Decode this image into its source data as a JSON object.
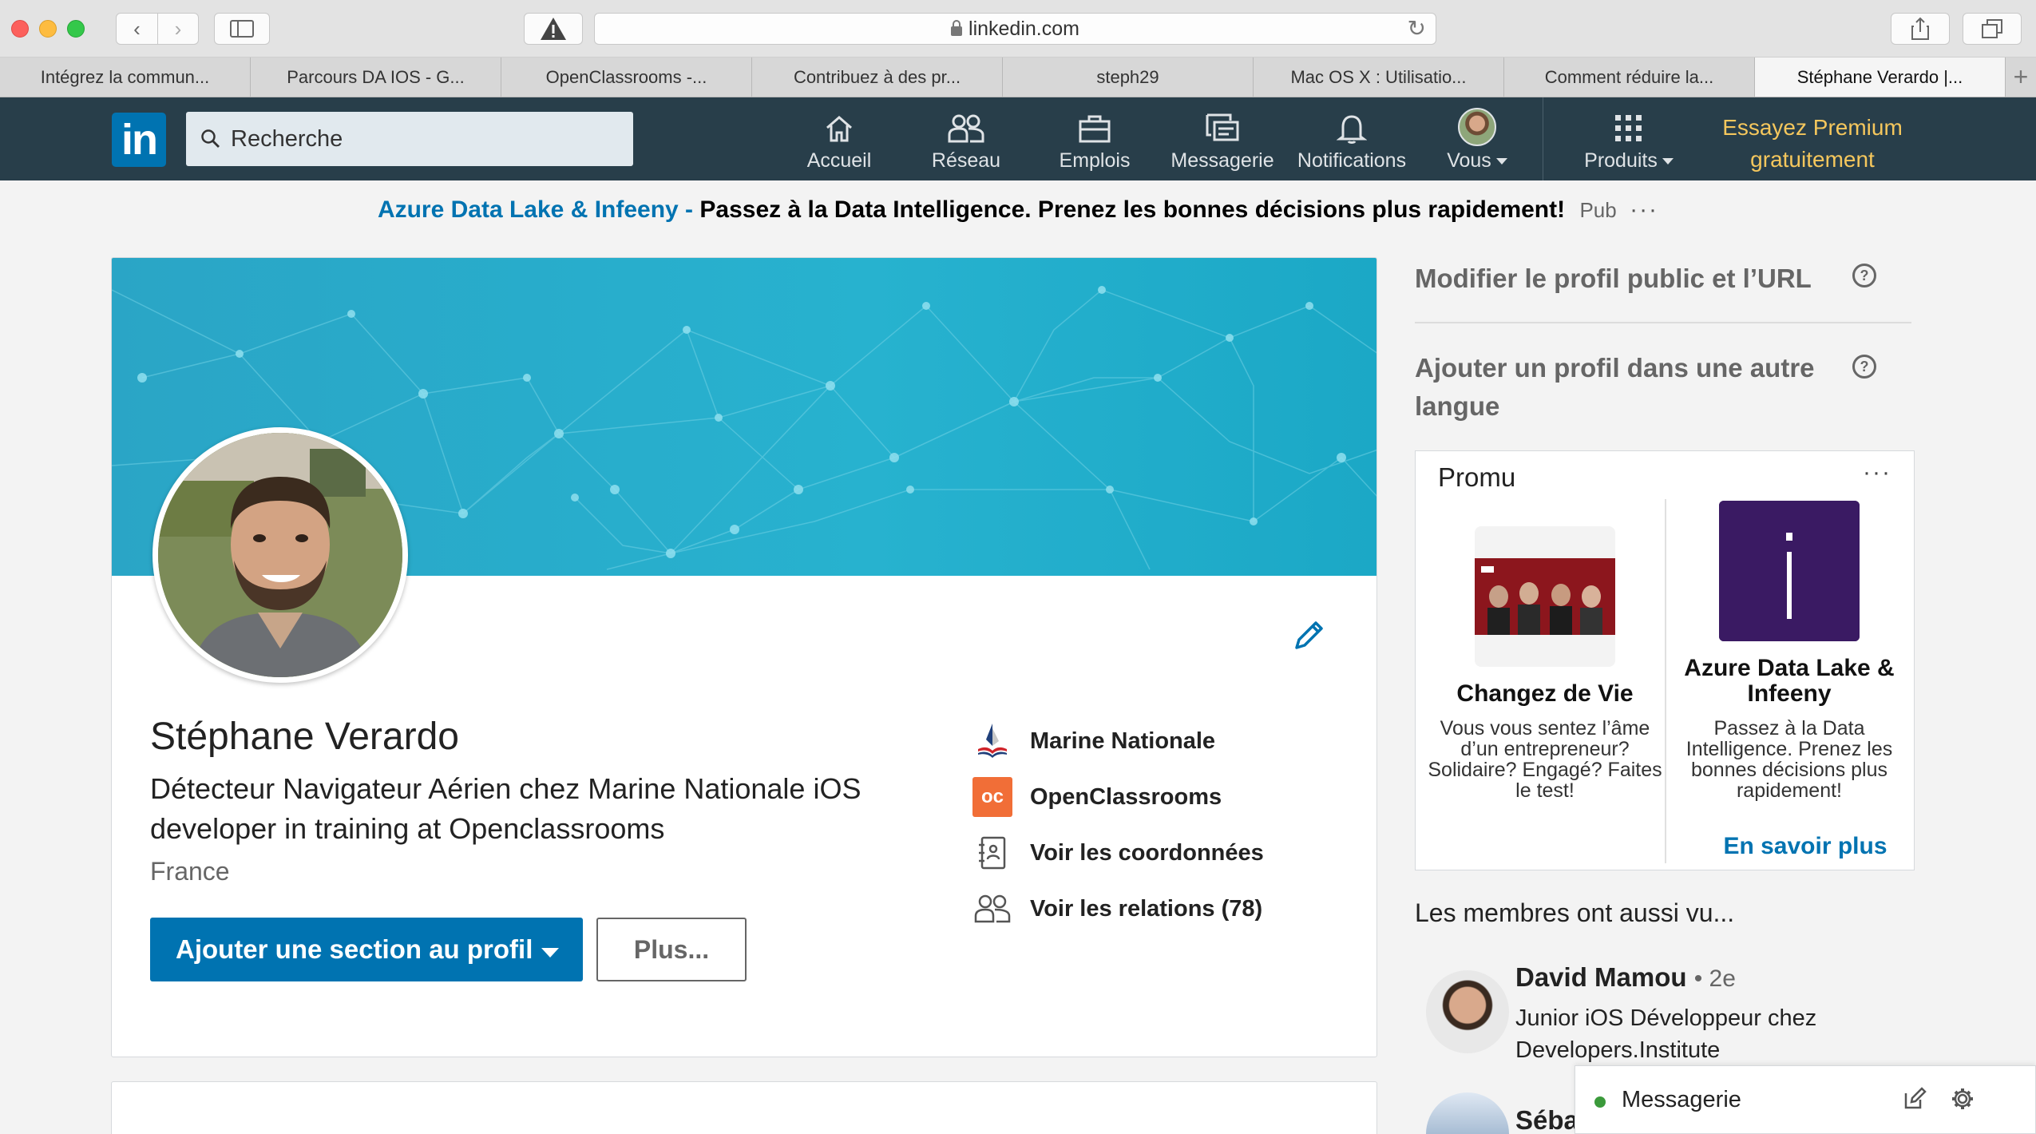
{
  "browser": {
    "url": "linkedin.com",
    "tabs": [
      {
        "label": "Intégrez la commun...",
        "active": false
      },
      {
        "label": "Parcours DA IOS - G...",
        "active": false
      },
      {
        "label": "OpenClassrooms -...",
        "active": false
      },
      {
        "label": "Contribuez à des pr...",
        "active": false
      },
      {
        "label": "steph29",
        "active": false
      },
      {
        "label": "Mac OS X : Utilisatio...",
        "active": false
      },
      {
        "label": "Comment réduire la...",
        "active": false
      },
      {
        "label": "Stéphane Verardo |...",
        "active": true
      }
    ],
    "new_tab": "+"
  },
  "nav": {
    "logo": "in",
    "search_placeholder": "Recherche",
    "items": [
      {
        "label": "Accueil",
        "icon": "home-icon"
      },
      {
        "label": "Réseau",
        "icon": "network-icon"
      },
      {
        "label": "Emplois",
        "icon": "jobs-icon"
      },
      {
        "label": "Messagerie",
        "icon": "messaging-icon"
      },
      {
        "label": "Notifications",
        "icon": "bell-icon"
      },
      {
        "label": "Vous",
        "icon": "avatar"
      },
      {
        "label": "Produits",
        "icon": "grid-icon"
      }
    ],
    "premium_line1": "Essayez Premium",
    "premium_line2": "gratuitement"
  },
  "ad": {
    "sponsor": "Azure Data Lake & Infeeny -",
    "message": "Passez à la Data Intelligence. Prenez les bonnes décisions plus rapidement!",
    "tag": "Pub",
    "more": "···"
  },
  "profile": {
    "name": "Stéphane Verardo",
    "headline": "Détecteur Navigateur Aérien chez Marine Nationale iOS developer in training at Openclassrooms",
    "location": "France",
    "add_section_button": "Ajouter une section au profil",
    "more_button": "Plus...",
    "side": [
      {
        "label": "Marine Nationale",
        "icon": "marine-nationale-logo"
      },
      {
        "label": "OpenClassrooms",
        "icon": "openclassrooms-logo"
      },
      {
        "label": "Voir les coordonnées",
        "icon": "contact-card-icon"
      },
      {
        "label": "Voir les relations (78)",
        "icon": "connections-icon"
      }
    ]
  },
  "rail": {
    "edit_public_profile": "Modifier le profil public et l’URL",
    "add_language_profile": "Ajouter un profil dans une autre langue",
    "help_glyph": "?",
    "promo": {
      "title": "Promu",
      "more": "···",
      "items": [
        {
          "name": "Changez de Vie",
          "desc": "Vous vous sentez l’âme d’un entrepreneur? Solidaire? Engagé? Faites le test!"
        },
        {
          "name": "Azure Data Lake & Infeeny",
          "desc": "Passez à la Data Intelligence. Prenez les bonnes décisions plus rapidement!",
          "logo_letter": "i"
        }
      ],
      "cta": "En savoir plus"
    },
    "also_viewed_title": "Les membres ont aussi vu...",
    "people": [
      {
        "name": "David Mamou",
        "degree": "• 2e",
        "title": "Junior iOS Développeur chez Developers.Institute"
      },
      {
        "name": "Séba"
      }
    ]
  },
  "messaging": {
    "label": "Messagerie"
  },
  "colors": {
    "linkedin_blue": "#0073b1",
    "nav_bg": "#283e4a",
    "premium_gold": "#f5c75d",
    "cover_teal": "#27b2cf"
  }
}
